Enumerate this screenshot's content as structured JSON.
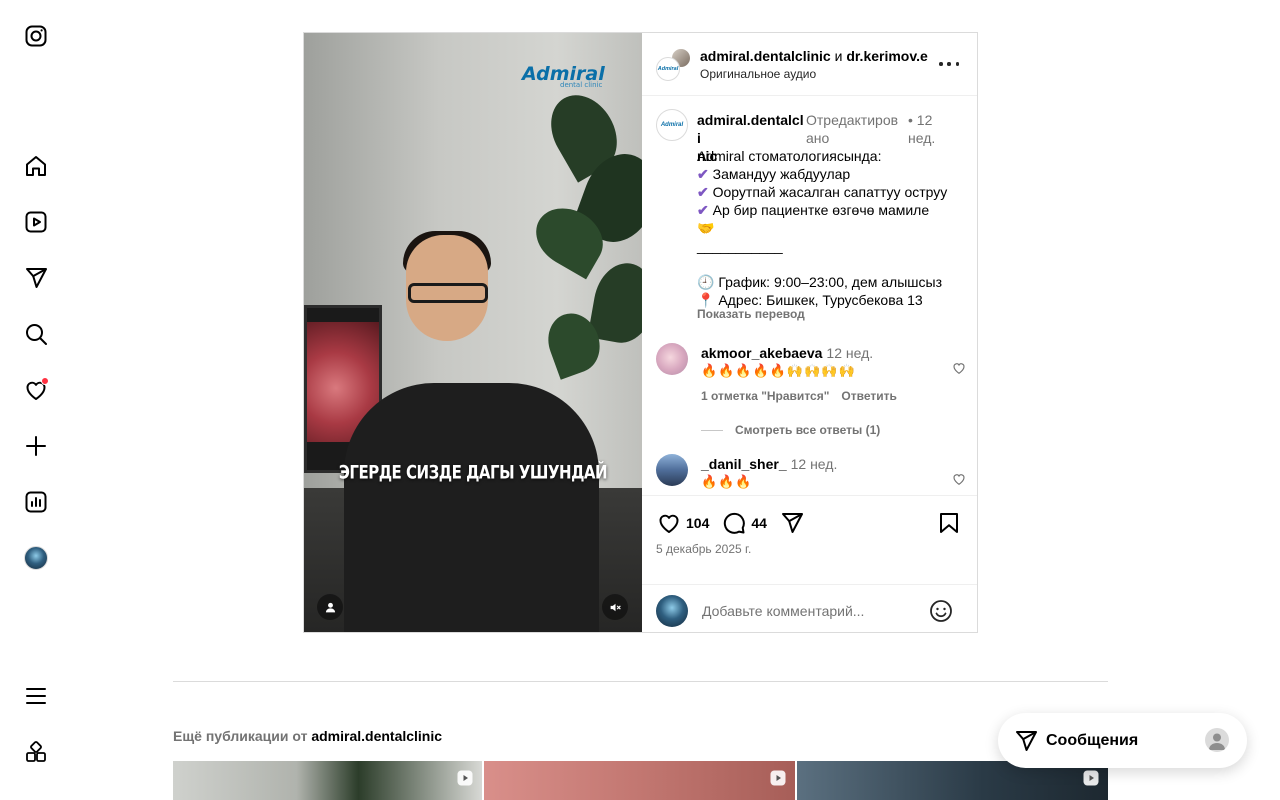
{
  "post": {
    "header": {
      "author": "admiral.dentalclinic",
      "connector": "и",
      "coauthor": "dr.kerimov.e",
      "audio": "Оригинальное аудио"
    },
    "media": {
      "brand_logo": "Admiral",
      "brand_logo_sub": "dental clinic",
      "overlay_caption": "ЭГЕРДЕ СИЗДЕ ДАГЫ УШУНДАЙ"
    },
    "caption": {
      "username_line1": "admiral.dentalcli",
      "username_line2": "nic",
      "edited_line1": "Отредактиров",
      "edited_line2": "ано",
      "time_line1": "• 12",
      "time_line2": "нед.",
      "intro": "Admiral стоматологиясында:",
      "check_glyph": "✔",
      "item1": "Замандуу жабдуулар",
      "item2": "Оорутпай жасалган сапаттуу оструу",
      "item3": "Ар бир пациентке өзгөчө мамиле",
      "handshake": "🤝",
      "separator": "___________",
      "schedule_icon": "🕘",
      "schedule": "График: 9:00–23:00, дем алышсыз",
      "address_icon": "📍",
      "address": "Адрес: Бишкек, Турусбекова 13",
      "translate": "Показать перевод"
    },
    "comments": [
      {
        "username": "akmoor_akebaeva",
        "time": "12 нед.",
        "text": "🔥🔥🔥🔥🔥🙌🙌🙌🙌",
        "likes": "1 отметка \"Нравится\"",
        "reply": "Ответить",
        "view_replies": "Смотреть все ответы (1)"
      },
      {
        "username": "_danil_sher_",
        "time": "12 нед.",
        "text": "🔥🔥🔥"
      }
    ],
    "actions": {
      "likes": "104",
      "comments": "44",
      "date": "5 декабрь 2025 г.",
      "comment_placeholder": "Добавьте комментарий..."
    }
  },
  "more_section": {
    "prefix": "Ещё публикации от",
    "account": "admiral.dentalclinic"
  },
  "messages_bubble": {
    "label": "Сообщения"
  },
  "colors": {
    "accent_check": "#7e57c2",
    "notification_dot": "#ff3040",
    "brand_blue": "#0a6fa8"
  },
  "icons": {
    "sidebar": [
      "instagram-icon",
      "home-icon",
      "reels-icon",
      "send-icon",
      "search-icon",
      "heart-icon",
      "create-icon",
      "stats-icon",
      "profile-avatar",
      "menu-icon",
      "apps-icon"
    ]
  }
}
